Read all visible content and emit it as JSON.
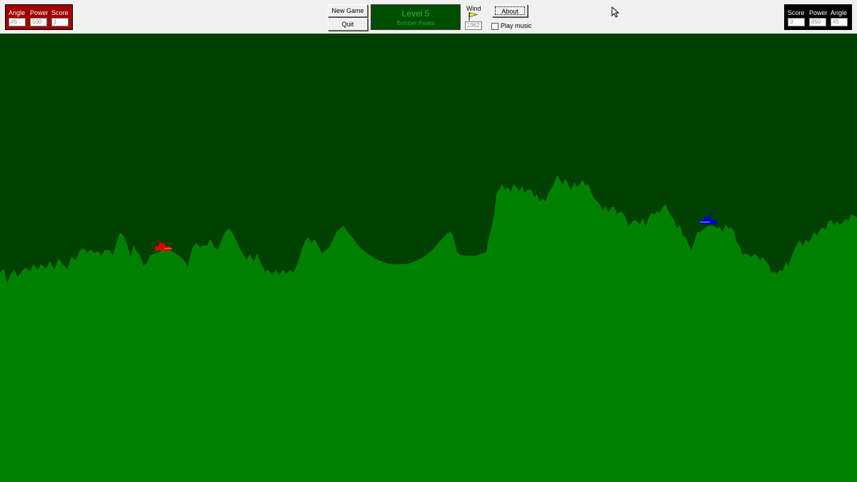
{
  "player_red": {
    "angle_label": "Angle",
    "power_label": "Power",
    "score_label": "Score",
    "angle": "45",
    "power": "500",
    "score": "1"
  },
  "player_blue": {
    "score_label": "Score",
    "power_label": "Power",
    "angle_label": "Angle",
    "score": "3",
    "power": "850",
    "angle": "45"
  },
  "buttons": {
    "new_game": "New Game",
    "quit": "Quit",
    "about": "About"
  },
  "level": {
    "title": "Level 5",
    "name": "Bomber Peaks"
  },
  "wind": {
    "label": "Wind",
    "value": "1962"
  },
  "music": {
    "label": "Play music",
    "checked": false
  },
  "colors": {
    "sky": "#004000",
    "ground": "#008000",
    "red_tank": "#e00000",
    "blue_tank": "#0000c8",
    "red_panel": "#a00000",
    "black_panel": "#000000",
    "level_bg": "#004d00",
    "level_text": "#22c02a",
    "flag": "#ffff00"
  },
  "icons": {
    "wind_flag": "flag-icon",
    "cursor": "mouse-pointer-icon"
  }
}
